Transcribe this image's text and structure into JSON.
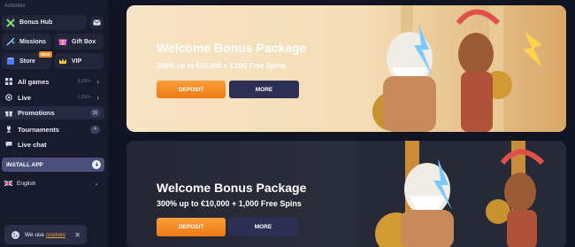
{
  "sidebar": {
    "section_label": "Activities",
    "bonus_hub": "Bonus Hub",
    "missions": "Missions",
    "gift_box": "Gift Box",
    "store": "Store",
    "store_badge": "NEW",
    "vip": "VIP",
    "menu": [
      {
        "label": "All games",
        "count": "8,200+",
        "icon": "dice-icon"
      },
      {
        "label": "Live",
        "count": "1,200+",
        "icon": "live-icon"
      },
      {
        "label": "Promotions",
        "count": "36",
        "icon": "gift-icon",
        "active": true
      },
      {
        "label": "Tournaments",
        "count": "4",
        "icon": "trophy-icon"
      },
      {
        "label": "Live chat",
        "icon": "chat-icon"
      }
    ],
    "install_app": "INSTALL APP",
    "language": "English"
  },
  "cookie": {
    "text": "We use",
    "link": "cookies"
  },
  "banners": [
    {
      "title": "Welcome Bonus Package",
      "subtitle": "300% up to €10,000 + 1,000 Free Spins",
      "deposit": "DEPOSIT",
      "more": "MORE"
    },
    {
      "title": "Welcome Bonus Package",
      "subtitle": "300% up to €10,000 + 1,000 Free Spins",
      "deposit": "DEPOSIT",
      "more": "MORE"
    }
  ],
  "colors": {
    "accent": "#f08a24",
    "sidebar_bg": "#181b2b",
    "page_bg": "#111423",
    "more_btn": "#2e2f55"
  }
}
